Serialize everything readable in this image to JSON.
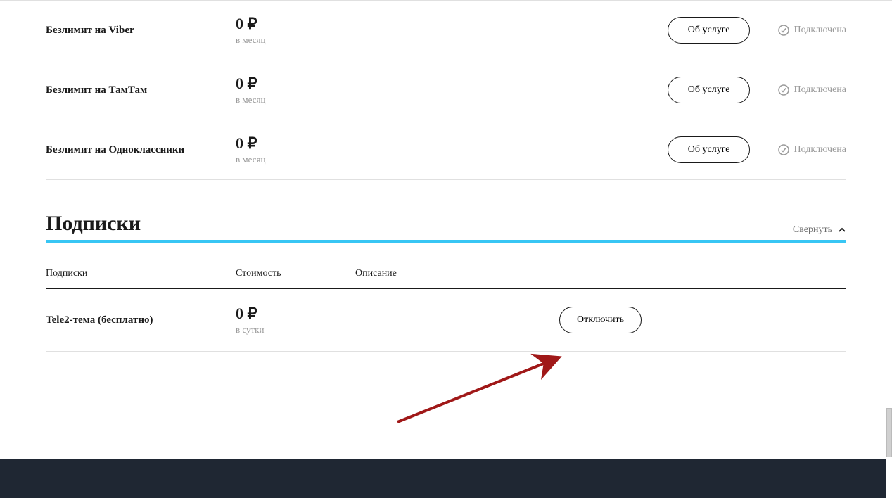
{
  "services": [
    {
      "name": "Безлимит на Viber",
      "price": "0 ₽",
      "period": "в месяц",
      "about": "Об услуге",
      "status": "Подключена"
    },
    {
      "name": "Безлимит на ТамТам",
      "price": "0 ₽",
      "period": "в месяц",
      "about": "Об услуге",
      "status": "Подключена"
    },
    {
      "name": "Безлимит на Одноклассники",
      "price": "0 ₽",
      "period": "в месяц",
      "about": "Об услуге",
      "status": "Подключена"
    }
  ],
  "section": {
    "title": "Подписки",
    "collapse": "Свернуть"
  },
  "subs_header": {
    "col1": "Подписки",
    "col2": "Стоимость",
    "col3": "Описание"
  },
  "subscriptions": [
    {
      "name": "Tele2-тема (бесплатно)",
      "price": "0 ₽",
      "period": "в сутки",
      "disable": "Отключить"
    }
  ]
}
